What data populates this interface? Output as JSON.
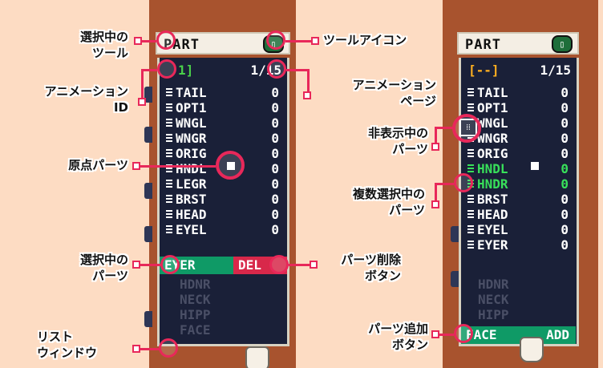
{
  "left_panel": {
    "header_title": "PART",
    "tool_icon": "tool-icon",
    "id_display": "1]",
    "page_display": "1/15",
    "items": [
      {
        "name": "TAIL",
        "value": "0"
      },
      {
        "name": "OPT1",
        "value": "0"
      },
      {
        "name": "WNGL",
        "value": "0"
      },
      {
        "name": "WNGR",
        "value": "0"
      },
      {
        "name": "ORIG",
        "value": "0"
      },
      {
        "name": "HNDL",
        "value": "0"
      },
      {
        "name": "LEGR",
        "value": "0"
      },
      {
        "name": "BRST",
        "value": "0"
      },
      {
        "name": "HEAD",
        "value": "0"
      },
      {
        "name": "EYEL",
        "value": "0"
      }
    ],
    "selected_item": "EYER",
    "delete_label": "DEL",
    "dim_items": [
      "HDNR",
      "NECK",
      "HIPP",
      "FACE"
    ]
  },
  "right_panel": {
    "header_title": "PART",
    "id_display": "[--]",
    "page_display": "1/15",
    "items": [
      {
        "name": "TAIL",
        "value": "0",
        "style": "normal"
      },
      {
        "name": "OPT1",
        "value": "0",
        "style": "normal"
      },
      {
        "name": "WNGL",
        "value": "0",
        "style": "normal"
      },
      {
        "name": "WNGR",
        "value": "0",
        "style": "normal"
      },
      {
        "name": "ORIG",
        "value": "0",
        "style": "normal"
      },
      {
        "name": "HNDL",
        "value": "0",
        "style": "green"
      },
      {
        "name": "HNDR",
        "value": "0",
        "style": "green"
      },
      {
        "name": "BRST",
        "value": "0",
        "style": "normal"
      },
      {
        "name": "HEAD",
        "value": "0",
        "style": "normal"
      },
      {
        "name": "EYEL",
        "value": "0",
        "style": "normal"
      },
      {
        "name": "EYER",
        "value": "0",
        "style": "normal"
      }
    ],
    "dim_items": [
      "HDNR",
      "NECK",
      "HIPP"
    ],
    "add_name": "FACE",
    "add_label": "ADD"
  },
  "annotations": {
    "selected_tool": "選択中の\nツール",
    "tool_icon": "ツールアイコン",
    "animation_id": "アニメーション\nID",
    "animation_page": "アニメーション\nページ",
    "origin_part": "原点パーツ",
    "hidden_part": "非表示中の\nパーツ",
    "multi_selected": "複数選択中の\nパーツ",
    "selected_part": "選択中の\nパーツ",
    "delete_button": "パーツ削除\nボタン",
    "list_window": "リスト\nウィンドウ",
    "add_button": "パーツ追加\nボタン"
  },
  "colors": {
    "background": "#fddcc3",
    "panel_brown": "#a8532e",
    "list_bg": "#1a2038",
    "accent_pink": "#e8285a",
    "selection_green": "#0f9a66",
    "delete_red": "#d8284a",
    "multi_select_green": "#38e05a",
    "id_orange": "#ffb020"
  }
}
